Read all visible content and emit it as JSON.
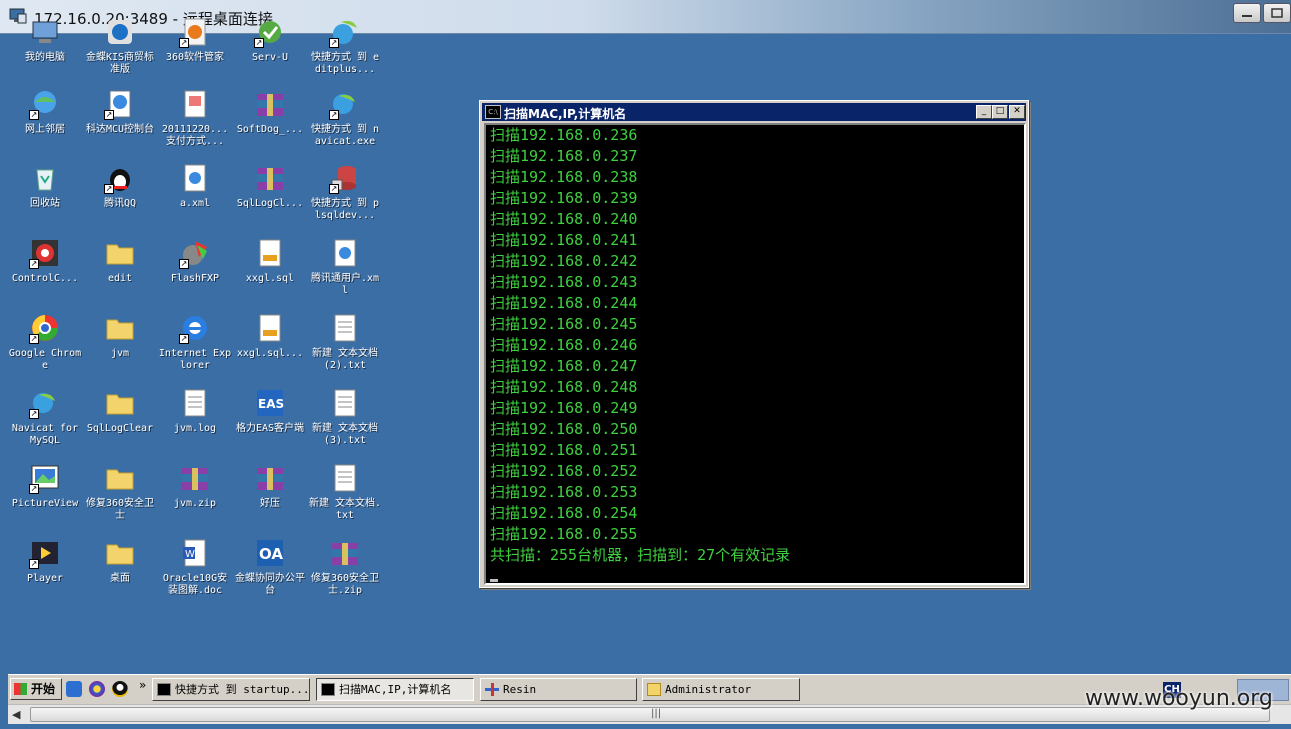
{
  "rdp": {
    "title": "172.16.0.20:3489 - 远程桌面连接"
  },
  "desktop_icons": [
    {
      "label": "我的电脑",
      "icon": "computer-icon"
    },
    {
      "label": "网上邻居",
      "icon": "network-icon"
    },
    {
      "label": "回收站",
      "icon": "recycle-bin-icon"
    },
    {
      "label": "ControlC...",
      "icon": "controlcenter-icon"
    },
    {
      "label": "Google Chrome",
      "icon": "chrome-icon"
    },
    {
      "label": "Navicat for MySQL",
      "icon": "navicat-icon"
    },
    {
      "label": "PictureView",
      "icon": "pictureview-icon"
    },
    {
      "label": "Player",
      "icon": "player-icon"
    },
    {
      "label": "金蝶KIS商贸标准版",
      "icon": "kingdee-icon"
    },
    {
      "label": "科达MCU控制台",
      "icon": "mcu-icon"
    },
    {
      "label": "腾讯QQ",
      "icon": "qq-icon"
    },
    {
      "label": "edit",
      "icon": "folder-icon"
    },
    {
      "label": "jvm",
      "icon": "folder-icon"
    },
    {
      "label": "SqlLogClear",
      "icon": "folder-icon"
    },
    {
      "label": "修复360安全卫士",
      "icon": "folder-icon"
    },
    {
      "label": "桌面",
      "icon": "folder-icon"
    },
    {
      "label": "360软件管家",
      "icon": "360-icon"
    },
    {
      "label": "20111220...支付方式...",
      "icon": "document-icon"
    },
    {
      "label": "a.xml",
      "icon": "xml-file-icon"
    },
    {
      "label": "FlashFXP",
      "icon": "flashfxp-icon"
    },
    {
      "label": "Internet Explorer",
      "icon": "ie-icon"
    },
    {
      "label": "jvm.log",
      "icon": "text-file-icon"
    },
    {
      "label": "jvm.zip",
      "icon": "archive-icon"
    },
    {
      "label": "Oracle10G安装图解.doc",
      "icon": "word-doc-icon"
    },
    {
      "label": "Serv-U",
      "icon": "servu-icon"
    },
    {
      "label": "SoftDog_...",
      "icon": "archive-icon"
    },
    {
      "label": "SqlLogCl...",
      "icon": "archive-icon"
    },
    {
      "label": "xxgl.sql",
      "icon": "sql-file-icon"
    },
    {
      "label": "xxgl.sql...",
      "icon": "sql-file-icon"
    },
    {
      "label": "格力EAS客户端",
      "icon": "eas-icon"
    },
    {
      "label": "好压",
      "icon": "archive-icon"
    },
    {
      "label": "金蝶协同办公平台",
      "icon": "oa-icon"
    },
    {
      "label": "快捷方式 到 editplus...",
      "icon": "editplus-icon"
    },
    {
      "label": "快捷方式 到 navicat.exe",
      "icon": "navicat-icon"
    },
    {
      "label": "快捷方式 到 plsqldev...",
      "icon": "plsql-icon"
    },
    {
      "label": "腾讯通用户.xml",
      "icon": "xml-file-icon"
    },
    {
      "label": "新建 文本文档 (2).txt",
      "icon": "text-file-icon"
    },
    {
      "label": "新建 文本文档 (3).txt",
      "icon": "text-file-icon"
    },
    {
      "label": "新建 文本文档.txt",
      "icon": "text-file-icon"
    },
    {
      "label": "修复360安全卫士.zip",
      "icon": "archive-icon"
    }
  ],
  "console": {
    "title": "扫描MAC,IP,计算机名",
    "lines": [
      "扫描192.168.0.236",
      "扫描192.168.0.237",
      "扫描192.168.0.238",
      "扫描192.168.0.239",
      "扫描192.168.0.240",
      "扫描192.168.0.241",
      "扫描192.168.0.242",
      "扫描192.168.0.243",
      "扫描192.168.0.244",
      "扫描192.168.0.245",
      "扫描192.168.0.246",
      "扫描192.168.0.247",
      "扫描192.168.0.248",
      "扫描192.168.0.249",
      "扫描192.168.0.250",
      "扫描192.168.0.251",
      "扫描192.168.0.252",
      "扫描192.168.0.253",
      "扫描192.168.0.254",
      "扫描192.168.0.255",
      "共扫描：255台机器，扫描到：27个有效记录"
    ],
    "text_color": "#3fd13f"
  },
  "taskbar": {
    "start_label": "开始",
    "chevron": "»",
    "tasks": [
      {
        "label": "快捷方式 到 startup...",
        "icon": "cmd-icon"
      },
      {
        "label": "扫描MAC,IP,计算机名",
        "icon": "cmd-icon"
      },
      {
        "label": "Resin",
        "icon": "resin-icon"
      },
      {
        "label": "Administrator",
        "icon": "folder-icon"
      }
    ],
    "tray_lang": "CH"
  },
  "watermark": "www.wooyun.org"
}
